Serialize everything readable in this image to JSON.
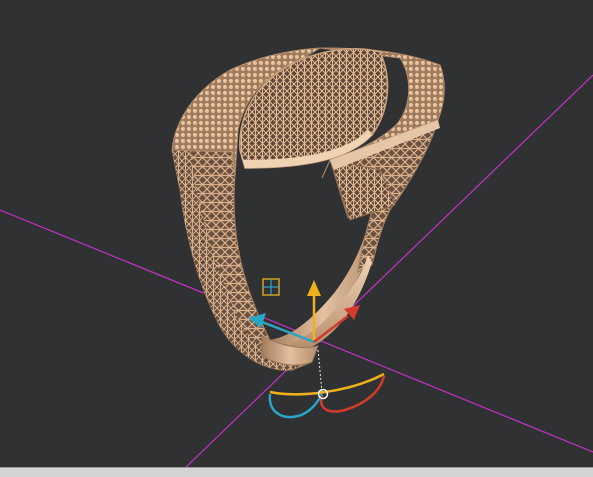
{
  "viewport": {
    "background": "#2f3133",
    "object": "ring-model",
    "material_color": "#c89f7b"
  },
  "axes": {
    "x_color": "#c533c5",
    "y_color": "#c533c5"
  },
  "gizmo": {
    "up_arrow_color": "#f0b11a",
    "left_arrow_color": "#2aa6c4",
    "right_arrow_color": "#d33a2c",
    "rotate_ring_colors": [
      "#f0b11a",
      "#2aa6c4",
      "#d33a2c"
    ],
    "plane_handle_color": "#d4a21a",
    "icons": [
      "move-up-arrow-icon",
      "move-left-arrow-icon",
      "move-right-arrow-icon",
      "rotate-gizmo-icon",
      "plane-handle-icon",
      "pivot-icon"
    ]
  },
  "status_bar": {
    "background": "#d4d4d4"
  }
}
